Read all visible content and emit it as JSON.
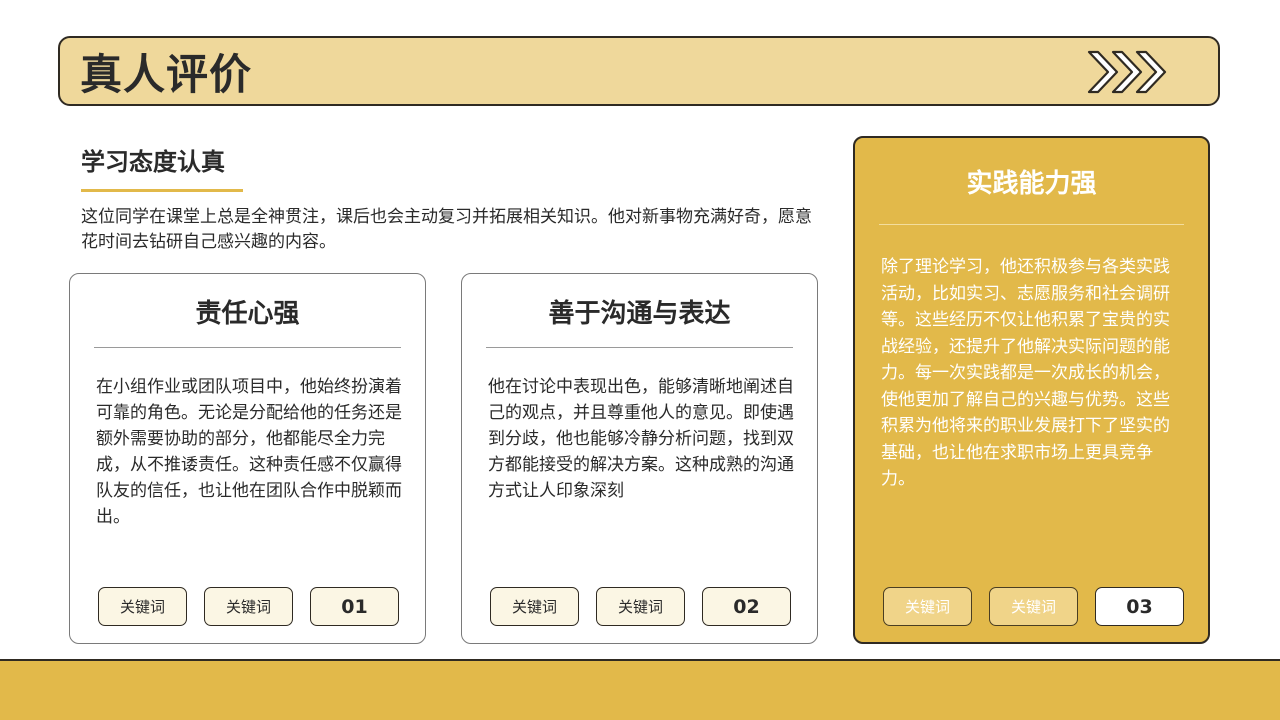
{
  "header": {
    "title": "真人评价",
    "decor_icon": "triple-chevron-right-icon"
  },
  "intro": {
    "heading": "学习态度认真",
    "text": "这位同学在课堂上总是全神贯注，课后也会主动复习并拓展相关知识。他对新事物充满好奇，愿意花时间去钻研自己感兴趣的内容。"
  },
  "cards": [
    {
      "title": "责任心强",
      "body": "在小组作业或团队项目中，他始终扮演着可靠的角色。无论是分配给他的任务还是额外需要协助的部分，他都能尽全力完成，从不推诿责任。这种责任感不仅赢得队友的信任，也让他在团队合作中脱颖而出。",
      "tags": [
        "关键词",
        "关键词"
      ],
      "number": "01"
    },
    {
      "title": "善于沟通与表达",
      "body": "他在讨论中表现出色，能够清晰地阐述自己的观点，并且尊重他人的意见。即使遇到分歧，他也能够冷静分析问题，找到双方都能接受的解决方案。这种成熟的沟通方式让人印象深刻",
      "tags": [
        "关键词",
        "关键词"
      ],
      "number": "02"
    },
    {
      "title": "实践能力强",
      "body": "除了理论学习，他还积极参与各类实践活动，比如实习、志愿服务和社会调研等。这些经历不仅让他积累了宝贵的实战经验，还提升了他解决实际问题的能力。每一次实践都是一次成长的机会，使他更加了解自己的兴趣与优势。这些积累为他将来的职业发展打下了坚实的基础，也让他在求职市场上更具竞争力。",
      "tags": [
        "关键词",
        "关键词"
      ],
      "number": "03"
    }
  ],
  "colors": {
    "accent": "#e2b94a",
    "title_bar": "#efd89b",
    "border": "#2f2a22",
    "text": "#2a2a2a"
  }
}
